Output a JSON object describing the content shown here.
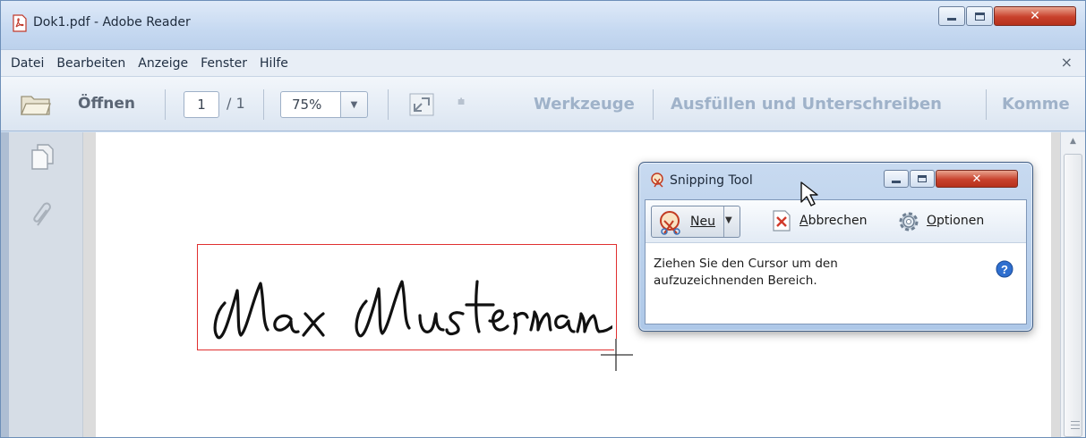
{
  "window": {
    "title": "Dok1.pdf - Adobe Reader"
  },
  "menu": {
    "items": [
      "Datei",
      "Bearbeiten",
      "Anzeige",
      "Fenster",
      "Hilfe"
    ],
    "close_glyph": "×"
  },
  "toolbar": {
    "open_label": "Öffnen",
    "page_current": "1",
    "page_total": "/ 1",
    "zoom": "75%",
    "tools_label": "Werkzeuge",
    "fill_sign_label": "Ausfüllen und Unterschreiben",
    "comment_label": "Komme"
  },
  "snipping_tool": {
    "title": "Snipping Tool",
    "new_label": "Neu",
    "cancel_label": "Abbrechen",
    "options_label": "Optionen",
    "instructions": "Ziehen Sie den Cursor um den aufzuzeichnenden Bereich."
  },
  "icons": {
    "app": "adobe-pdf-icon",
    "open": "folder-icon",
    "fit": "fullscreen-icon",
    "pages": "pages-icon",
    "attachments": "paperclip-icon",
    "snip_new": "scissors-icon",
    "snip_cancel": "cancel-icon",
    "snip_options": "gear-icon",
    "help": "help-icon"
  },
  "colors": {
    "selection": "#e03030",
    "disabled_label": "#9fb2c9"
  }
}
